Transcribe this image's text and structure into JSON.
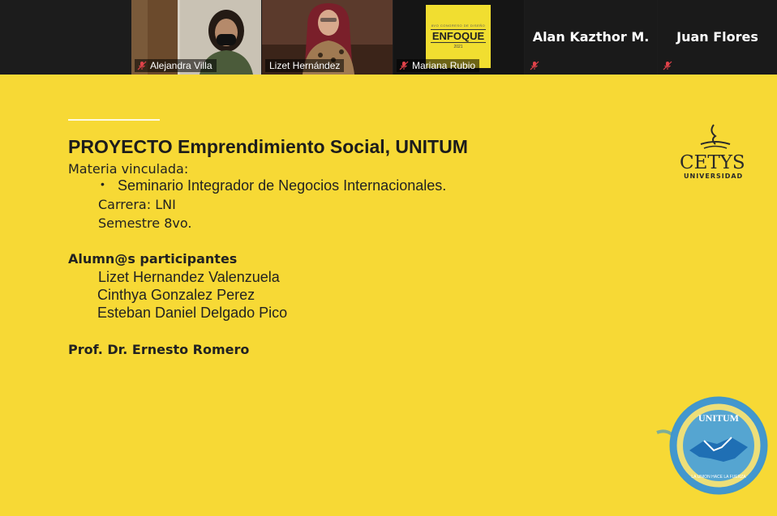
{
  "participants": [
    {
      "name": "Alejandra Villa",
      "muted": true,
      "video": true
    },
    {
      "name": "Lizet Hernández",
      "muted": false,
      "video": true,
      "active_speaker": true
    },
    {
      "name": "Mariana Rubio",
      "muted": true,
      "video": true
    },
    {
      "name": "Alan Kazthor M.",
      "muted": true,
      "video": false
    },
    {
      "name": "Juan Flores",
      "muted": true,
      "video": false
    }
  ],
  "enfoque_card": {
    "small": "8VO CONGRESO DE DISEÑO",
    "word": "ENFOQUE",
    "year": "2021"
  },
  "slide": {
    "title": "PROYECTO Emprendimiento Social, UNITUM",
    "materia_label": "Materia vinculada:",
    "materia_item": "Seminario Integrador de Negocios Internacionales.",
    "bullet": "•",
    "carrera": "Carrera: LNI",
    "semestre": "Semestre 8vo.",
    "alumnos_heading": "Alumn@s participantes",
    "alumnos": [
      "Lizet Hernandez Valenzuela",
      "Cinthya Gonzalez Perez",
      "Esteban Daniel Delgado Pico"
    ],
    "profesor": "Prof. Dr. Ernesto Romero",
    "cetys_name": "CETYS",
    "cetys_sub": "UNIVERSIDAD",
    "unitum_name": "UNITUM",
    "unitum_motto": "LA UNION HACE LA FUERZA"
  },
  "colors": {
    "slide_background": "#f7d935",
    "strip_background": "#1c1c1c",
    "active_speaker_border": "#a5d93f",
    "muted_icon": "#e0424a",
    "unitum_blue": "#2f8fd8"
  },
  "icons": {
    "muted": "mic-muted-icon",
    "cetys_logo": "flame-logo-icon",
    "unitum_logo": "handshake-icon"
  }
}
